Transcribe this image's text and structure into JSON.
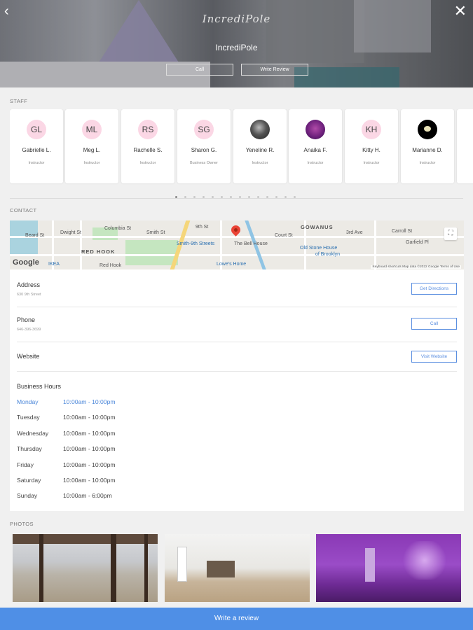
{
  "hero": {
    "logo_text": "IncrediPole",
    "business_name": "IncrediPole",
    "call_label": "Call",
    "review_label": "Write Review"
  },
  "staff": {
    "section_label": "STAFF",
    "members": [
      {
        "initials": "GL",
        "name": "Gabrielle L.",
        "role": "Instructor"
      },
      {
        "initials": "ML",
        "name": "Meg L.",
        "role": "Instructor"
      },
      {
        "initials": "RS",
        "name": "Rachelle S.",
        "role": "Instructor"
      },
      {
        "initials": "SG",
        "name": "Sharon G.",
        "role": "Business Owner"
      },
      {
        "initials": "",
        "name": "Yeneline R.",
        "role": "Instructor"
      },
      {
        "initials": "",
        "name": "Anaika F.",
        "role": "Instructor"
      },
      {
        "initials": "KH",
        "name": "Kitty H.",
        "role": "Instructor"
      },
      {
        "initials": "",
        "name": "Marianne D.",
        "role": "Instructor"
      }
    ]
  },
  "contact": {
    "section_label": "CONTACT",
    "map": {
      "labels": [
        "RED HOOK",
        "GOWANUS",
        "Smith-9th Streets",
        "The Bell House",
        "Old Stone House",
        "of Brooklyn",
        "IKEA",
        "Lowe's Home",
        "Red Hook",
        "9th St",
        "Court St",
        "Smith St",
        "Carroll St",
        "3rd Ave",
        "Garfield Pl",
        "Columbia St",
        "Dwight St",
        "Beard St"
      ],
      "google_text": "Google",
      "attribution": "Keyboard shortcuts   Map data ©2022 Google   Terms of Use"
    },
    "address_label": "Address",
    "address_value": "630 9th Street",
    "directions_label": "Get Directions",
    "phone_label": "Phone",
    "phone_value": "646-396-3699",
    "call_label": "Call",
    "website_label": "Website",
    "website_button": "Visit Website",
    "hours_title": "Business Hours",
    "hours": [
      {
        "day": "Monday",
        "time": "10:00am - 10:00pm"
      },
      {
        "day": "Tuesday",
        "time": "10:00am - 10:00pm"
      },
      {
        "day": "Wednesday",
        "time": "10:00am - 10:00pm"
      },
      {
        "day": "Thursday",
        "time": "10:00am - 10:00pm"
      },
      {
        "day": "Friday",
        "time": "10:00am - 10:00pm"
      },
      {
        "day": "Saturday",
        "time": "10:00am - 10:00pm"
      },
      {
        "day": "Sunday",
        "time": "10:00am - 6:00pm"
      }
    ],
    "today": "Monday",
    "today_color": "#4a86d9"
  },
  "photos": {
    "section_label": "PHOTOS"
  },
  "bottom_bar": {
    "label": "Write a review",
    "color": "#4f8fe6"
  },
  "carousel": {
    "page_count": 14,
    "active_page": 0
  },
  "icons": {
    "back": "chevron-left-icon",
    "close": "close-icon",
    "fullscreen": "fullscreen-icon",
    "map_pin": "map-pin-icon"
  }
}
